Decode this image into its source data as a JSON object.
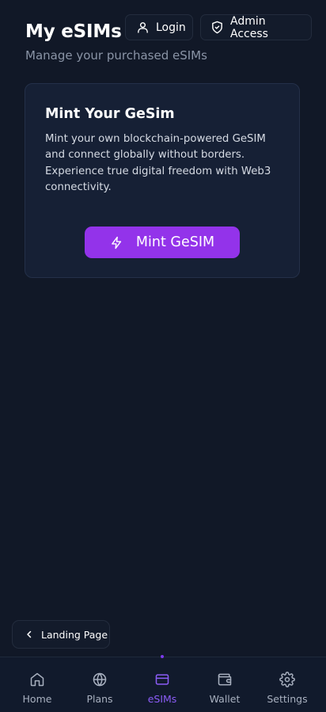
{
  "header": {
    "title": "My eSIMs",
    "subtitle": "Manage your purchased eSIMs",
    "login_label": "Login",
    "admin_label": "Admin Access"
  },
  "mint_card": {
    "title": "Mint Your GeSim",
    "description": "Mint your own blockchain-powered GeSIM and connect globally without borders. Experience true digital freedom with Web3 connectivity.",
    "button_label": "Mint GeSIM"
  },
  "landing_button": {
    "label": "Landing Page"
  },
  "bottom_nav": {
    "items": [
      {
        "label": "Home",
        "icon": "home-icon",
        "active": false
      },
      {
        "label": "Plans",
        "icon": "globe-icon",
        "active": false
      },
      {
        "label": "eSIMs",
        "icon": "credit-card-icon",
        "active": true
      },
      {
        "label": "Wallet",
        "icon": "wallet-icon",
        "active": false
      },
      {
        "label": "Settings",
        "icon": "gear-icon",
        "active": false
      }
    ]
  },
  "colors": {
    "background": "#111827",
    "accent": "#9333ea",
    "active_nav": "#8b5cf6",
    "muted_text": "#8a94a6"
  }
}
